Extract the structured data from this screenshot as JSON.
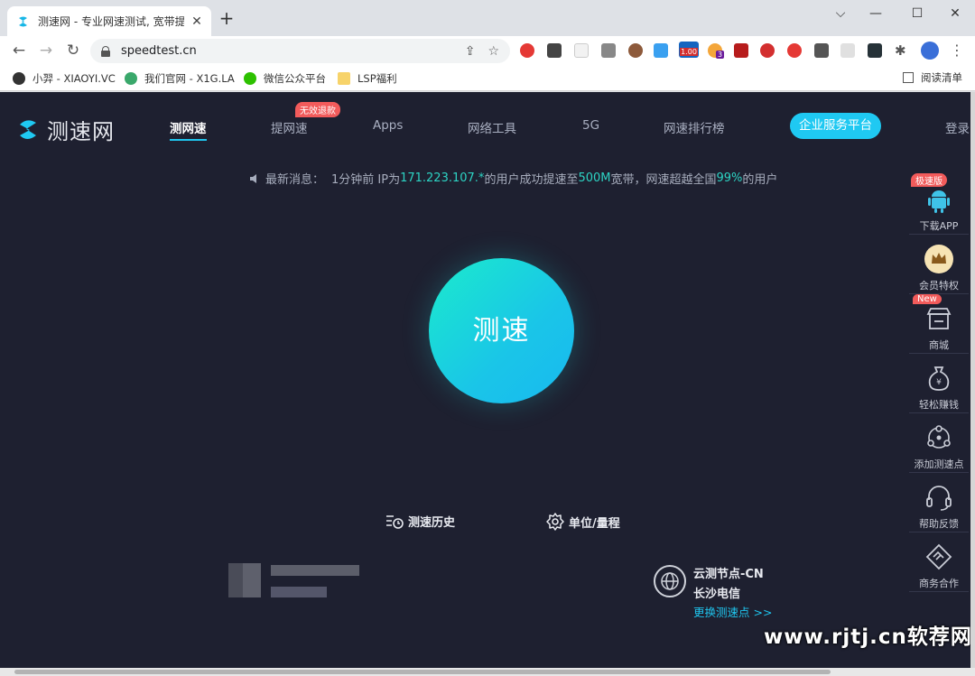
{
  "browser": {
    "tab_title": "测速网 - 专业网速测试, 宽带提速",
    "url": "speedtest.cn",
    "extensions": [
      "1.00",
      "3"
    ],
    "bookmarks": [
      {
        "label": "小羿 - XIAOYI.VC"
      },
      {
        "label": "我们官网 - X1G.LA"
      },
      {
        "label": "微信公众平台"
      },
      {
        "label": "LSP福利"
      }
    ],
    "reading_list": "阅读清单"
  },
  "site": {
    "logo_text": "测速网",
    "nav": [
      {
        "label": "测网速"
      },
      {
        "label": "提网速"
      },
      {
        "label": "Apps"
      },
      {
        "label": "网络工具"
      },
      {
        "label": "5G"
      },
      {
        "label": "网速排行榜"
      }
    ],
    "nav_badge": "无效退款",
    "enterprise_button": "企业服务平台",
    "login": "登录",
    "news": {
      "prefix": "最新消息：",
      "time": "1分钟前 IP为",
      "ip": "171.223.107.*",
      "mid": "的用户成功提速至",
      "speed": "500M",
      "mid2": "宽带，网速超越全国",
      "percent": "99%",
      "suffix": "的用户"
    },
    "go_button": "测速",
    "history": "测速历史",
    "units": "单位/量程",
    "server": {
      "name": "云测节点-CN",
      "carrier": "长沙电信",
      "change": "更换测速点 >>"
    }
  },
  "sidebar": {
    "items": [
      {
        "label": "下载APP",
        "badge": "极速版",
        "icon": "android-icon"
      },
      {
        "label": "会员特权",
        "icon": "crown-icon"
      },
      {
        "label": "商城",
        "badge": "New",
        "icon": "shop-icon"
      },
      {
        "label": "轻松赚钱",
        "icon": "money-bag-icon"
      },
      {
        "label": "添加测速点",
        "icon": "node-icon"
      },
      {
        "label": "帮助反馈",
        "icon": "headset-icon"
      },
      {
        "label": "商务合作",
        "icon": "handshake-icon"
      }
    ]
  },
  "watermark": "www.rjtj.cn软荐网",
  "colors": {
    "page_bg": "#1e2030",
    "accent": "#1fc5ee",
    "highlight": "#2dd4c4",
    "badge": "#f25b5b"
  }
}
